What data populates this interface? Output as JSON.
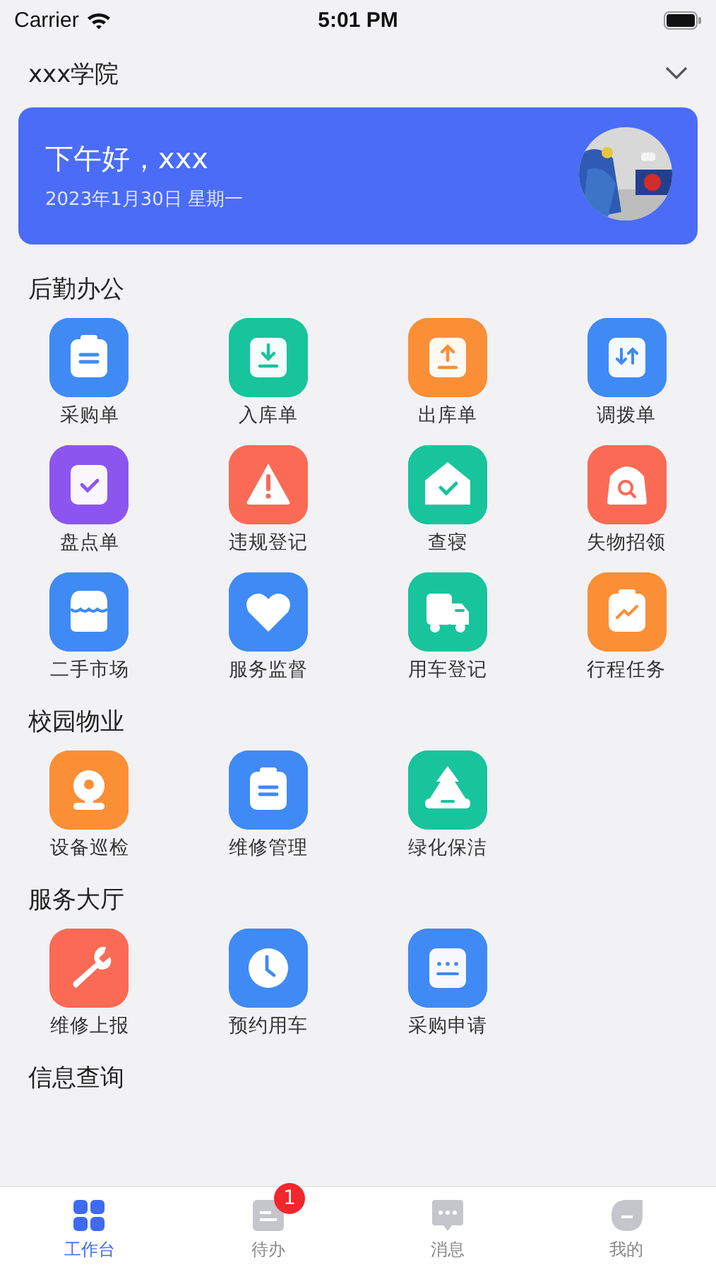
{
  "status_bar": {
    "carrier": "Carrier",
    "time": "5:01 PM"
  },
  "header": {
    "title": "xxx学院"
  },
  "banner": {
    "greeting": "下午好，xxx",
    "date": "2023年1月30日 星期一"
  },
  "sections": [
    {
      "title": "后勤办公",
      "items": [
        {
          "label": "采购单",
          "kind": "clipboard",
          "color": "#3f8af5"
        },
        {
          "label": "入库单",
          "kind": "download",
          "color": "#17c49c"
        },
        {
          "label": "出库单",
          "kind": "upload",
          "color": "#fb8f36"
        },
        {
          "label": "调拨单",
          "kind": "swap",
          "color": "#3f8af5"
        },
        {
          "label": "盘点单",
          "kind": "check",
          "color": "#8c55f0"
        },
        {
          "label": "违规登记",
          "kind": "warning",
          "color": "#fb6a55"
        },
        {
          "label": "查寝",
          "kind": "house",
          "color": "#17c49c"
        },
        {
          "label": "失物招领",
          "kind": "bag",
          "color": "#fb6a55"
        },
        {
          "label": "二手市场",
          "kind": "store",
          "color": "#3f8af5"
        },
        {
          "label": "服务监督",
          "kind": "heart",
          "color": "#3f8af5"
        },
        {
          "label": "用车登记",
          "kind": "truck",
          "color": "#17c49c"
        },
        {
          "label": "行程任务",
          "kind": "chart",
          "color": "#fb8f36"
        }
      ]
    },
    {
      "title": "校园物业",
      "items": [
        {
          "label": "设备巡检",
          "kind": "camera",
          "color": "#fb8f36"
        },
        {
          "label": "维修管理",
          "kind": "clipboard",
          "color": "#3f8af5"
        },
        {
          "label": "绿化保洁",
          "kind": "tree",
          "color": "#17c49c"
        }
      ]
    },
    {
      "title": "服务大厅",
      "items": [
        {
          "label": "维修上报",
          "kind": "wrench",
          "color": "#fb6a55"
        },
        {
          "label": "预约用车",
          "kind": "clock",
          "color": "#3f8af5"
        },
        {
          "label": "采购申请",
          "kind": "keyboard",
          "color": "#3f8af5"
        }
      ]
    },
    {
      "title": "信息查询"
    }
  ],
  "tab_bar": [
    {
      "label": "工作台",
      "kind": "grid",
      "selected": true
    },
    {
      "label": "待办",
      "kind": "todo",
      "selected": false,
      "badge": "1"
    },
    {
      "label": "消息",
      "kind": "chat",
      "selected": false
    },
    {
      "label": "我的",
      "kind": "user",
      "selected": false
    }
  ]
}
